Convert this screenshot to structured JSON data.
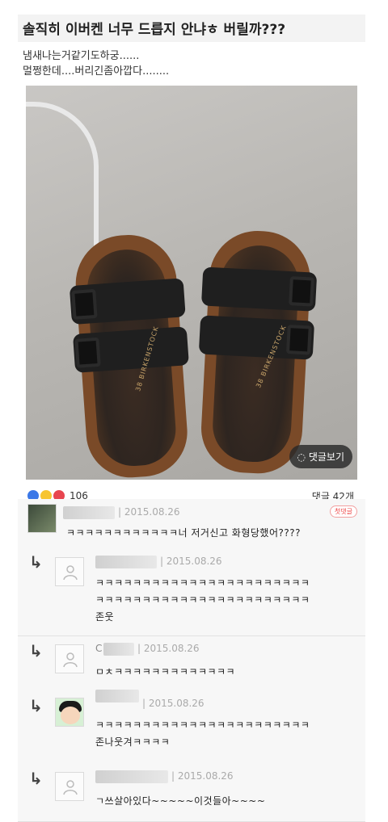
{
  "post": {
    "title": "솔직히 이버켄 너무 드릅지 안냐ㅎ 버릴까???",
    "body_line1": "냄새나는거같기도하궁......",
    "body_line2": "멀쩡한데....버리긴좀아깝다........",
    "photo_brand_text": "38 BIRKENSTOCK",
    "comment_button": "댓글보기"
  },
  "reactions": {
    "icons": [
      "like-icon",
      "haha-icon",
      "love-icon"
    ],
    "count": "106"
  },
  "comment_count": "댓글 42개",
  "comments": [
    {
      "date": "2015.08.26",
      "badge": "첫댓글",
      "text": "ㅋㅋㅋㅋㅋㅋㅋㅋㅋㅋㅋㅋ너 저거신고 화형당했어????"
    }
  ],
  "replies": [
    {
      "date": "2015.08.26",
      "line1": "ㅋㅋㅋㅋㅋㅋㅋㅋㅋㅋㅋㅋㅋㅋㅋㅋㅋㅋㅋㅋㅋㅋㅋ",
      "line2": "ㅋㅋㅋㅋㅋㅋㅋㅋㅋㅋㅋㅋㅋㅋㅋㅋㅋㅋㅋㅋㅋㅋㅋ",
      "line3": "존웃"
    },
    {
      "nick_prefix": "C",
      "date": "2015.08.26",
      "line1": "ㅁㅊㅋㅋㅋㅋㅋㅋㅋㅋㅋㅋㅋㅋㅋ"
    },
    {
      "date": "2015.08.26",
      "line1": "ㅋㅋㅋㅋㅋㅋㅋㅋㅋㅋㅋㅋㅋㅋㅋㅋㅋㅋㅋㅋㅋㅋㅋ",
      "line2": "존나웃겨ㅋㅋㅋㅋ"
    },
    {
      "date": "2015.08.26",
      "line1": "ㄱ쓰살아있다~~~~~이것들아~~~~"
    }
  ],
  "colors": {
    "title_bg": "#f3f3f3",
    "comment_bg": "#f7f7f7",
    "like": "#3b78e7",
    "haha": "#f7c531",
    "love": "#e8454f",
    "badge": "#e44444"
  }
}
